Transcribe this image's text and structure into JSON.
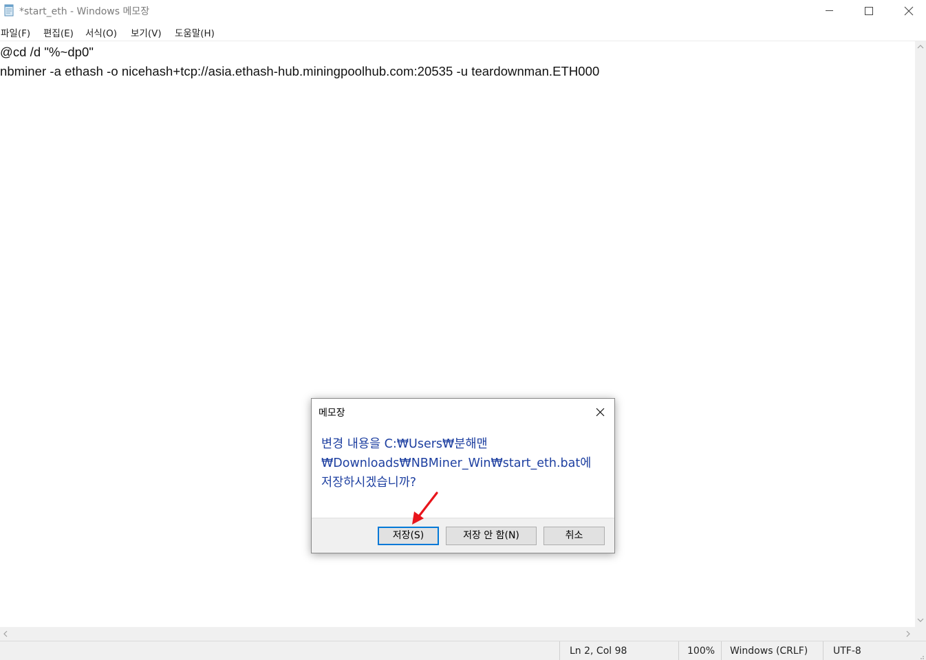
{
  "window": {
    "title": "*start_eth - Windows 메모장",
    "app_icon": "notepad-icon",
    "controls": [
      "minimize-icon",
      "maximize-icon",
      "close-icon"
    ]
  },
  "menu": {
    "items": [
      "파일(F)",
      "편집(E)",
      "서식(O)",
      "보기(V)",
      "도움말(H)"
    ]
  },
  "editor": {
    "lines": [
      "@cd /d \"%~dp0\"",
      "nbminer -a ethash -o nicehash+tcp://asia.ethash-hub.miningpoolhub.com:20535 -u teardownman.ETH000"
    ]
  },
  "status": {
    "position": "Ln 2, Col 98",
    "zoom": "100%",
    "line_ending": "Windows (CRLF)",
    "encoding": "UTF-8"
  },
  "dialog": {
    "title": "메모장",
    "message_lines": [
      "변경 내용을 C:₩Users₩분해맨",
      "₩Downloads₩NBMiner_Win₩start_eth.bat에",
      "저장하시겠습니까?"
    ],
    "save_label": "저장(S)",
    "dont_save_label": "저장 안 함(N)",
    "cancel_label": "취소"
  },
  "colors": {
    "dialog_message": "#1d3fa0",
    "focus_border": "#0078d7",
    "annotation_arrow": "#e8141b"
  }
}
